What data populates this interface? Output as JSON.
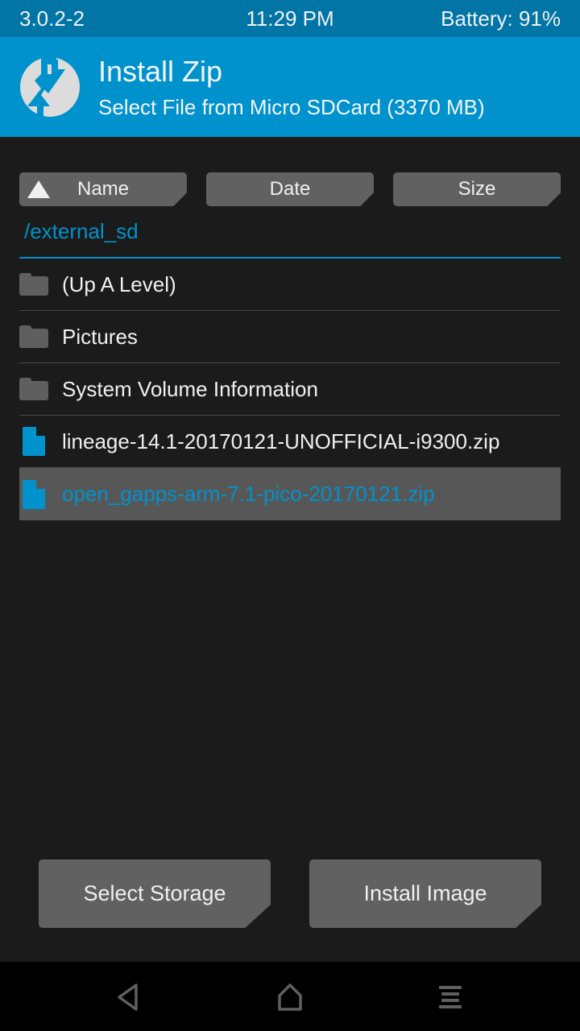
{
  "status_bar": {
    "version": "3.0.2-2",
    "time": "11:29 PM",
    "battery": "Battery: 91%"
  },
  "header": {
    "logo_icon": "twrp-logo-icon",
    "title": "Install Zip",
    "subtitle": "Select File from Micro SDCard (3370 MB)"
  },
  "sort_bar": {
    "buttons": [
      {
        "label": "Name",
        "active": true,
        "direction": "ascending"
      },
      {
        "label": "Date",
        "active": false
      },
      {
        "label": "Size",
        "active": false
      }
    ]
  },
  "current_path": "/external_sd",
  "files": [
    {
      "name": "(Up A Level)",
      "type": "folder",
      "icon": "folder-icon",
      "selected": false
    },
    {
      "name": "Pictures",
      "type": "folder",
      "icon": "folder-icon",
      "selected": false
    },
    {
      "name": "System Volume Information",
      "type": "folder",
      "icon": "folder-icon",
      "selected": false
    },
    {
      "name": "lineage-14.1-20170121-UNOFFICIAL-i9300.zip",
      "type": "file",
      "icon": "file-icon",
      "selected": false
    },
    {
      "name": "open_gapps-arm-7.1-pico-20170121.zip",
      "type": "file",
      "icon": "file-icon",
      "selected": true
    }
  ],
  "actions": {
    "select_storage": "Select Storage",
    "install_image": "Install Image"
  },
  "nav_bar": {
    "back_icon": "back-triangle-icon",
    "home_icon": "home-icon",
    "menu_icon": "menu-lines-icon"
  },
  "colors": {
    "accent": "#0092cc",
    "status_bar": "#0075a6",
    "background": "#1b1b1b",
    "button": "#616161",
    "selected_row": "#575757"
  }
}
